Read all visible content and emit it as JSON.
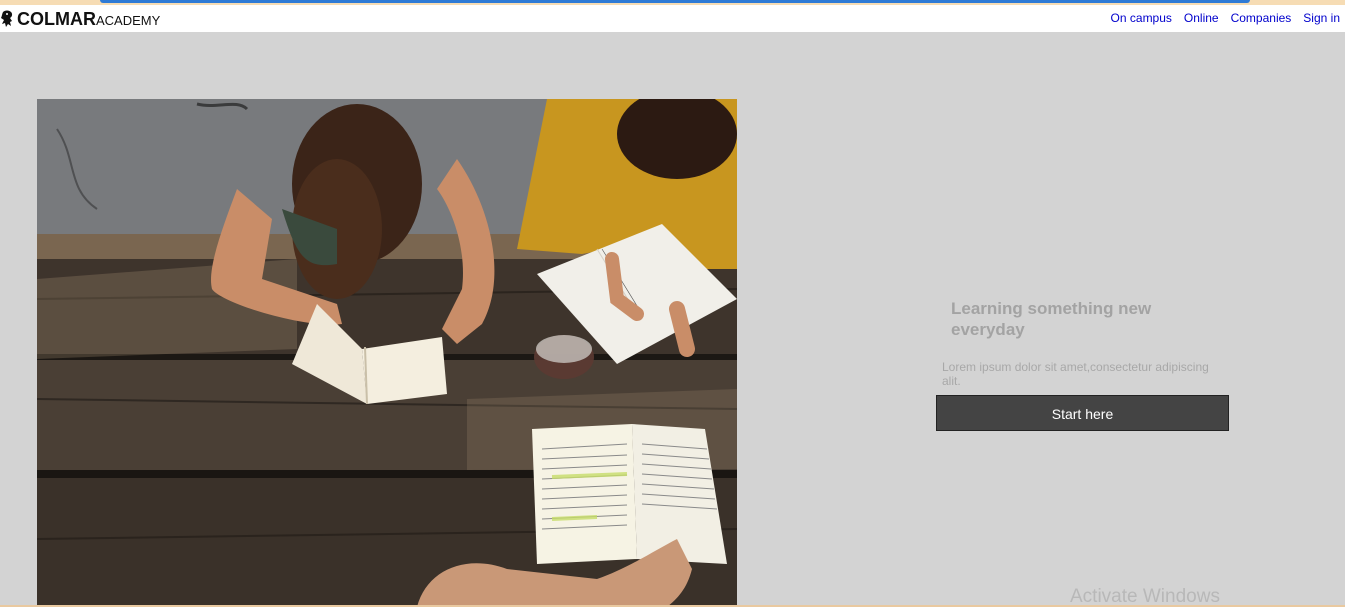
{
  "navbar": {
    "brand_name": "COLMAR",
    "brand_sub": "ACADEMY",
    "links": [
      {
        "label": "On campus"
      },
      {
        "label": "Online"
      },
      {
        "label": "Companies"
      },
      {
        "label": "Sign in"
      }
    ],
    "link_color": "#0000cc"
  },
  "hero": {
    "image_icon": "students-studying-photo",
    "heading": "Learning something new everyday",
    "text": "Lorem ipsum dolor sit amet,consectetur adipiscing alit.",
    "button_label": "Start here"
  },
  "os": {
    "watermark": "Activate Windows"
  },
  "colors": {
    "background": "#d3d3d3",
    "navbar": "#ffffff",
    "button": "#444444",
    "muted_text": "#a3a3a3"
  }
}
